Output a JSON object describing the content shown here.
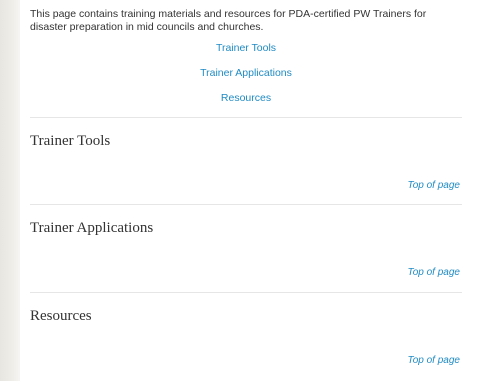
{
  "intro_text": "This page contains training materials and resources for PDA-certified PW Trainers for disaster preparation in mid councils and churches.",
  "toc": [
    {
      "label": "Trainer Tools"
    },
    {
      "label": "Trainer Applications"
    },
    {
      "label": "Resources"
    }
  ],
  "sections": [
    {
      "title": "Trainer Tools",
      "top_link": "Top of page"
    },
    {
      "title": "Trainer Applications",
      "top_link": "Top of page"
    },
    {
      "title": "Resources",
      "top_link": "Top of page"
    }
  ],
  "colors": {
    "link": "#1f8bc4",
    "text": "#333333",
    "divider": "#e6e6e6"
  }
}
